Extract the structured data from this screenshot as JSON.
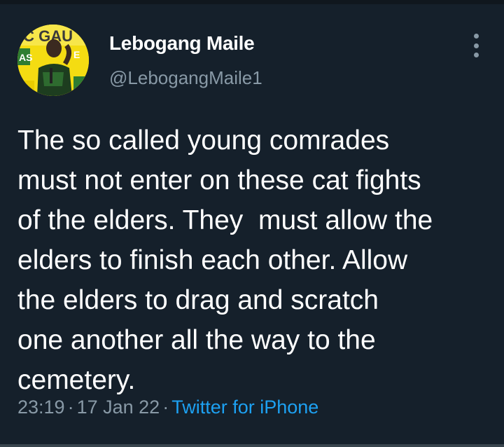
{
  "colors": {
    "background": "#15202b",
    "text_primary": "#ffffff",
    "text_secondary": "#8899a6",
    "link": "#1da1f2",
    "avatar_bg": "#f2d90a"
  },
  "tweet": {
    "author": {
      "display_name": "Lebogang Maile",
      "handle": "@LebogangMaile1",
      "avatar_sign_text": "IC GAU",
      "avatar_sign_text_lower": "AS"
    },
    "more_icon": "more-vertical-icon",
    "text_lines": [
      "The so called young comrades",
      "must not enter on these cat fights",
      "of the elders. They  must allow the",
      "elders to finish each other. Allow",
      "the elders to drag and scratch",
      "one another all the way to the",
      "cemetery."
    ],
    "meta": {
      "time": "23:19",
      "separator": "·",
      "date": "17 Jan 22",
      "source": "Twitter for iPhone"
    }
  }
}
